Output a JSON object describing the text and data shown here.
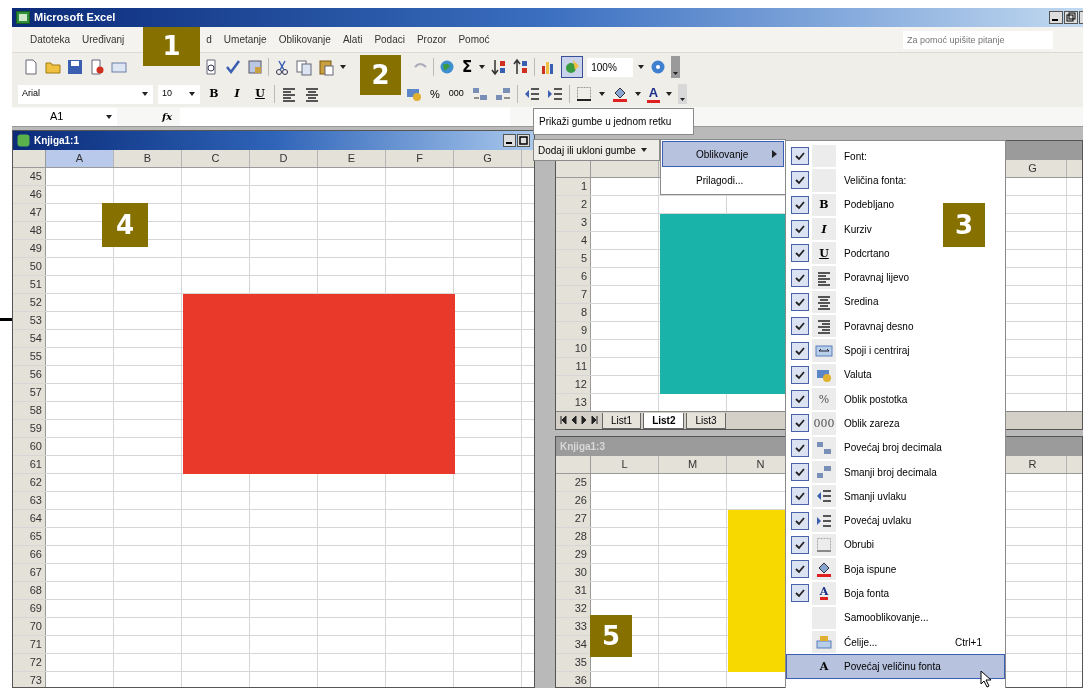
{
  "app_window": {
    "title": "Microsoft Excel"
  },
  "menu_bar": [
    "Datoteka",
    "Uređivanj",
    "d",
    "Umetanje",
    "Oblikovanje",
    "Alati",
    "Podaci",
    "Prozor",
    "Pomoć"
  ],
  "help_box": {
    "placeholder": "Za pomoć upišite pitanje"
  },
  "standard_toolbar": {
    "sum_symbol": "Σ",
    "zoom": "100%"
  },
  "formatting_toolbar": {
    "font": "Arial",
    "size": "10",
    "bold": "B",
    "italic": "I",
    "underline": "U",
    "percent": "%",
    "thousands": "000",
    "font_color": "A"
  },
  "formula_bar": {
    "name_box": "A1",
    "function_label": "fx"
  },
  "toolbar_options_popup": {
    "label": "Prikaži gumbe u jednom retku"
  },
  "add_remove_button": {
    "label": "Dodaj ili ukloni gumbe"
  },
  "toolbar_submenu": [
    {
      "label": "Oblikovanje",
      "selected": true,
      "submenu": true
    },
    {
      "label": "Prilagodi...",
      "selected": false,
      "submenu": false
    }
  ],
  "buttons_menu": [
    {
      "label": "Font:",
      "checked": true,
      "selected": false
    },
    {
      "label": "Veličina fonta:",
      "checked": true,
      "selected": false
    },
    {
      "label": "Podebljano",
      "checked": true,
      "selected": false,
      "glyph": "B"
    },
    {
      "label": "Kurziv",
      "checked": true,
      "selected": false,
      "glyph": "I"
    },
    {
      "label": "Podcrtano",
      "checked": true,
      "selected": false,
      "glyph": "U"
    },
    {
      "label": "Poravnaj lijevo",
      "checked": true,
      "selected": false
    },
    {
      "label": "Sredina",
      "checked": true,
      "selected": false
    },
    {
      "label": "Poravnaj desno",
      "checked": true,
      "selected": false
    },
    {
      "label": "Spoji i centriraj",
      "checked": true,
      "selected": false
    },
    {
      "label": "Valuta",
      "checked": true,
      "selected": false
    },
    {
      "label": "Oblik postotka",
      "checked": true,
      "selected": false,
      "glyph": "%"
    },
    {
      "label": "Oblik zareza",
      "checked": true,
      "selected": false,
      "glyph": "000"
    },
    {
      "label": "Povećaj broj decimala",
      "checked": true,
      "selected": false
    },
    {
      "label": "Smanji broj decimala",
      "checked": true,
      "selected": false
    },
    {
      "label": "Smanji uvlaku",
      "checked": true,
      "selected": false
    },
    {
      "label": "Povećaj uvlaku",
      "checked": true,
      "selected": false
    },
    {
      "label": "Obrubi",
      "checked": true,
      "selected": false
    },
    {
      "label": "Boja ispune",
      "checked": true,
      "selected": false
    },
    {
      "label": "Boja fonta",
      "checked": true,
      "selected": false,
      "glyph": "A"
    },
    {
      "label": "Samooblikovanje...",
      "checked": false,
      "selected": false
    },
    {
      "label": "Ćelije...",
      "checked": false,
      "selected": false,
      "shortcut": "Ctrl+1"
    },
    {
      "label": "Povećaj veličinu fonta",
      "checked": false,
      "selected": true,
      "glyph": "A"
    }
  ],
  "workbook_windows": [
    {
      "title": "Knjiga1:1",
      "active": true,
      "columns": [
        {
          "label": "A",
          "selected": true
        },
        {
          "label": "B",
          "selected": false
        },
        {
          "label": "C",
          "selected": false
        },
        {
          "label": "D",
          "selected": false
        },
        {
          "label": "E",
          "selected": false
        },
        {
          "label": "F",
          "selected": false
        },
        {
          "label": "G",
          "selected": false
        }
      ],
      "rows": [
        "45",
        "46",
        "47",
        "48",
        "49",
        "50",
        "51",
        "52",
        "53",
        "54",
        "55",
        "56",
        "57",
        "58",
        "59",
        "60",
        "61",
        "62",
        "63",
        "64",
        "65",
        "66",
        "67",
        "68",
        "69",
        "70",
        "71",
        "72",
        "73"
      ],
      "shape": {
        "color": "#e8392a"
      }
    },
    {
      "active": false,
      "columns": [
        {
          "label": "G",
          "selected": false
        }
      ],
      "rows": [
        "1",
        "2",
        "3",
        "4",
        "5",
        "6",
        "7",
        "8",
        "9",
        "10",
        "11",
        "12",
        "13"
      ],
      "sheet_tabs": [
        {
          "label": "List1",
          "selected": false
        },
        {
          "label": "List2",
          "selected": true
        },
        {
          "label": "List3",
          "selected": false
        }
      ],
      "shape": {
        "color": "#19b3aa"
      }
    },
    {
      "title": "Knjiga1:3",
      "active": false,
      "columns": [
        {
          "label": "L",
          "selected": false
        },
        {
          "label": "M",
          "selected": false
        },
        {
          "label": "N",
          "selected": false
        },
        {
          "label": "R",
          "selected": false
        }
      ],
      "rows": [
        "25",
        "26",
        "27",
        "28",
        "29",
        "30",
        "31",
        "32",
        "33",
        "34",
        "35",
        "36"
      ],
      "shape": {
        "color": "#f7d900"
      }
    }
  ],
  "callouts": [
    "1",
    "2",
    "3",
    "4",
    "5"
  ]
}
